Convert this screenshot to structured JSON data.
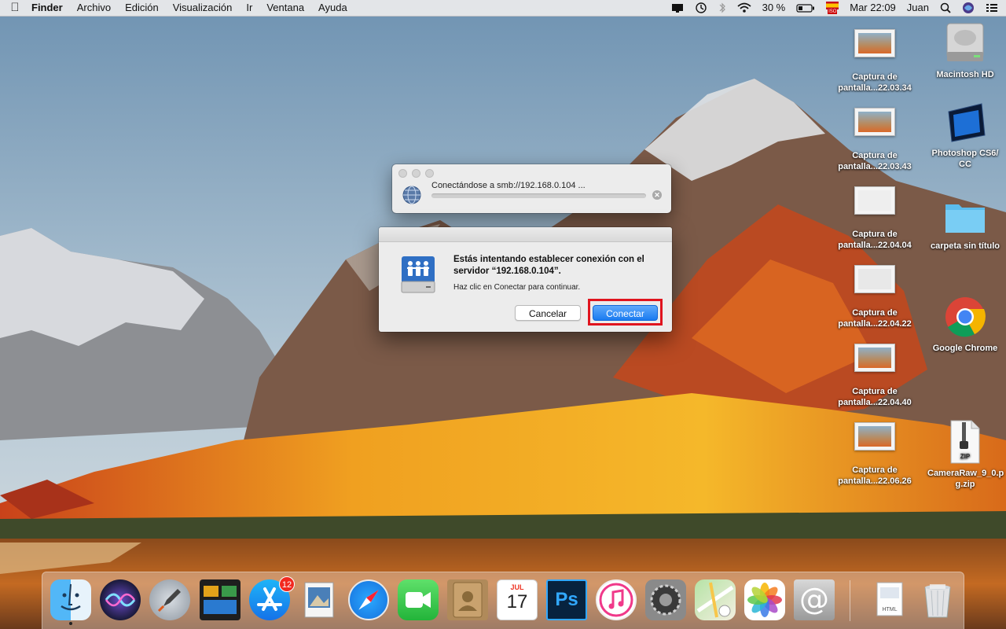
{
  "menubar": {
    "app_name": "Finder",
    "menus": [
      "Archivo",
      "Edición",
      "Visualización",
      "Ir",
      "Ventana",
      "Ayuda"
    ],
    "battery": "30 %",
    "clock": "Mar 22:09",
    "user": "Juan",
    "input_source_flag": "ES",
    "input_source_sub": "ISO"
  },
  "desktop_icons": [
    {
      "label_line1": "Captura de",
      "label_line2": "pantalla...22.03.34",
      "kind": "screenshot"
    },
    {
      "label_line1": "Captura de",
      "label_line2": "pantalla...22.03.43",
      "kind": "screenshot"
    },
    {
      "label_line1": "Captura de",
      "label_line2": "pantalla...22.04.04",
      "kind": "screenshot"
    },
    {
      "label_line1": "Captura de",
      "label_line2": "pantalla...22.04.22",
      "kind": "screenshot"
    },
    {
      "label_line1": "Captura de",
      "label_line2": "pantalla...22.04.40",
      "kind": "screenshot"
    },
    {
      "label_line1": "Captura de",
      "label_line2": "pantalla...22.06.26",
      "kind": "screenshot"
    },
    {
      "label_line1": "Macintosh HD",
      "label_line2": "",
      "kind": "hard-drive"
    },
    {
      "label_line1": "Photoshop CS6/",
      "label_line2": "CC",
      "kind": "photoshop"
    },
    {
      "label_line1": "carpeta sin título",
      "label_line2": "",
      "kind": "folder"
    },
    {
      "label_line1": "Google Chrome",
      "label_line2": "",
      "kind": "chrome"
    },
    {
      "label_line1": "CameraRaw_9_0.p",
      "label_line2": "g.zip",
      "kind": "zip"
    }
  ],
  "progress_window": {
    "status_text": "Conectándose a smb://192.168.0.104 ...",
    "progress": 0.0
  },
  "connect_sheet": {
    "heading": "Estás intentando establecer conexión con el servidor “192.168.0.104”.",
    "subtext": "Haz clic en Conectar para continuar.",
    "cancel_label": "Cancelar",
    "connect_label": "Conectar"
  },
  "dock": {
    "apps": [
      "finder",
      "siri",
      "launchpad",
      "mission-control",
      "app-store",
      "preview",
      "safari",
      "facetime",
      "contacts",
      "calendar",
      "photoshop",
      "itunes",
      "system-preferences",
      "maps",
      "photos",
      "mail"
    ],
    "app_store_badge": "12",
    "calendar_month": "JUL",
    "calendar_day": "17",
    "photoshop_label": "Ps",
    "html_doc_label": "HTML",
    "zip_label": "ZIP"
  },
  "colors": {
    "accent_blue": "#1a7bf0",
    "highlight_red": "#e0141e"
  }
}
